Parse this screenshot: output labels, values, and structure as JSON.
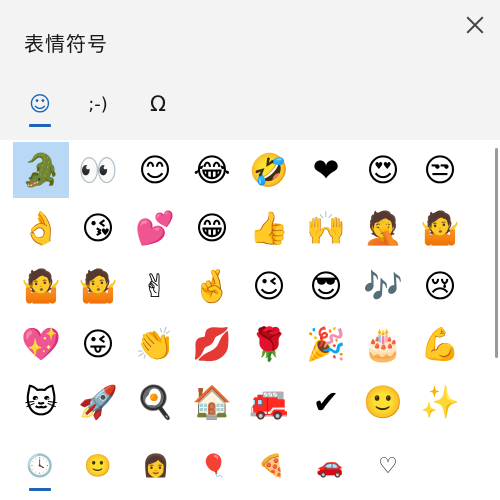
{
  "window": {
    "title": "表情符号"
  },
  "top_tabs": [
    {
      "name": "emoji",
      "glyph": "☺",
      "active": true
    },
    {
      "name": "kaomoji",
      "glyph": ";-)",
      "active": false
    },
    {
      "name": "symbols",
      "glyph": "Ω",
      "active": false
    }
  ],
  "emoji_grid": {
    "rows": [
      [
        "🐊",
        "👀",
        "😊",
        "😂",
        "🤣",
        "❤",
        "😍",
        "😒"
      ],
      [
        "👌",
        "😘",
        "💕",
        "😁",
        "👍",
        "🙌",
        "🤦",
        "🤷"
      ],
      [
        "🤷",
        "🤷",
        "✌",
        "🤞",
        "😉",
        "😎",
        "🎶",
        "😢"
      ],
      [
        "💖",
        "😜",
        "👏",
        "💋",
        "🌹",
        "🎉",
        "🎂",
        "💪"
      ],
      [
        "🐱",
        "🚀",
        "🍳",
        "🏠",
        "🚒",
        "✔",
        "🙂",
        "✨"
      ]
    ]
  },
  "bottom_tabs": [
    {
      "name": "recent",
      "glyph": "🕓",
      "active": true
    },
    {
      "name": "smileys",
      "glyph": "🙂",
      "active": false
    },
    {
      "name": "people",
      "glyph": "👩",
      "active": false
    },
    {
      "name": "celebration",
      "glyph": "🎈",
      "active": false
    },
    {
      "name": "food",
      "glyph": "🍕",
      "active": false
    },
    {
      "name": "transport",
      "glyph": "🚗",
      "active": false
    },
    {
      "name": "symbols",
      "glyph": "♡",
      "active": false
    }
  ]
}
